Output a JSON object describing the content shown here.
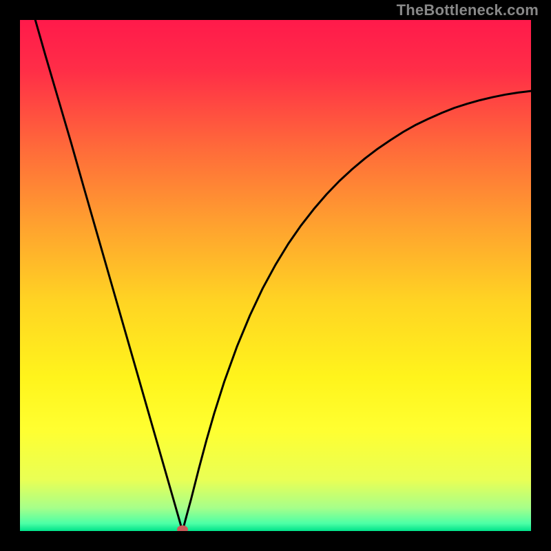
{
  "watermark": "TheBottleneck.com",
  "chart_data": {
    "type": "line",
    "title": "",
    "xlabel": "",
    "ylabel": "",
    "xlim": [
      0,
      1
    ],
    "ylim": [
      0,
      1
    ],
    "grid": false,
    "background_gradient": {
      "stops": [
        {
          "offset": 0.0,
          "color": "#ff1a4b"
        },
        {
          "offset": 0.1,
          "color": "#ff2e47"
        },
        {
          "offset": 0.25,
          "color": "#ff6a3a"
        },
        {
          "offset": 0.4,
          "color": "#ffa12f"
        },
        {
          "offset": 0.55,
          "color": "#ffd423"
        },
        {
          "offset": 0.7,
          "color": "#fff41c"
        },
        {
          "offset": 0.8,
          "color": "#ffff30"
        },
        {
          "offset": 0.9,
          "color": "#e9ff55"
        },
        {
          "offset": 0.955,
          "color": "#a6ff8a"
        },
        {
          "offset": 0.985,
          "color": "#4dffa6"
        },
        {
          "offset": 1.0,
          "color": "#00e28a"
        }
      ]
    },
    "optimum_marker": {
      "x": 0.318,
      "y": 0.003,
      "color": "#cc5a5a"
    },
    "series": [
      {
        "name": "bottleneck-curve",
        "color": "#000000",
        "width": 3,
        "x": [
          0.03,
          0.05,
          0.075,
          0.1,
          0.125,
          0.15,
          0.175,
          0.2,
          0.225,
          0.25,
          0.275,
          0.3,
          0.31,
          0.318,
          0.326,
          0.335,
          0.35,
          0.365,
          0.38,
          0.4,
          0.425,
          0.45,
          0.475,
          0.5,
          0.525,
          0.55,
          0.575,
          0.6,
          0.625,
          0.65,
          0.675,
          0.7,
          0.725,
          0.75,
          0.775,
          0.8,
          0.825,
          0.85,
          0.875,
          0.9,
          0.925,
          0.95,
          0.975,
          1.0
        ],
        "y": [
          1.0,
          0.93,
          0.845,
          0.76,
          0.672,
          0.585,
          0.498,
          0.411,
          0.324,
          0.237,
          0.15,
          0.063,
          0.028,
          0.0,
          0.03,
          0.063,
          0.122,
          0.178,
          0.23,
          0.293,
          0.362,
          0.422,
          0.475,
          0.521,
          0.562,
          0.598,
          0.63,
          0.659,
          0.685,
          0.708,
          0.729,
          0.748,
          0.765,
          0.781,
          0.795,
          0.807,
          0.818,
          0.828,
          0.836,
          0.843,
          0.849,
          0.854,
          0.858,
          0.861
        ]
      }
    ]
  }
}
